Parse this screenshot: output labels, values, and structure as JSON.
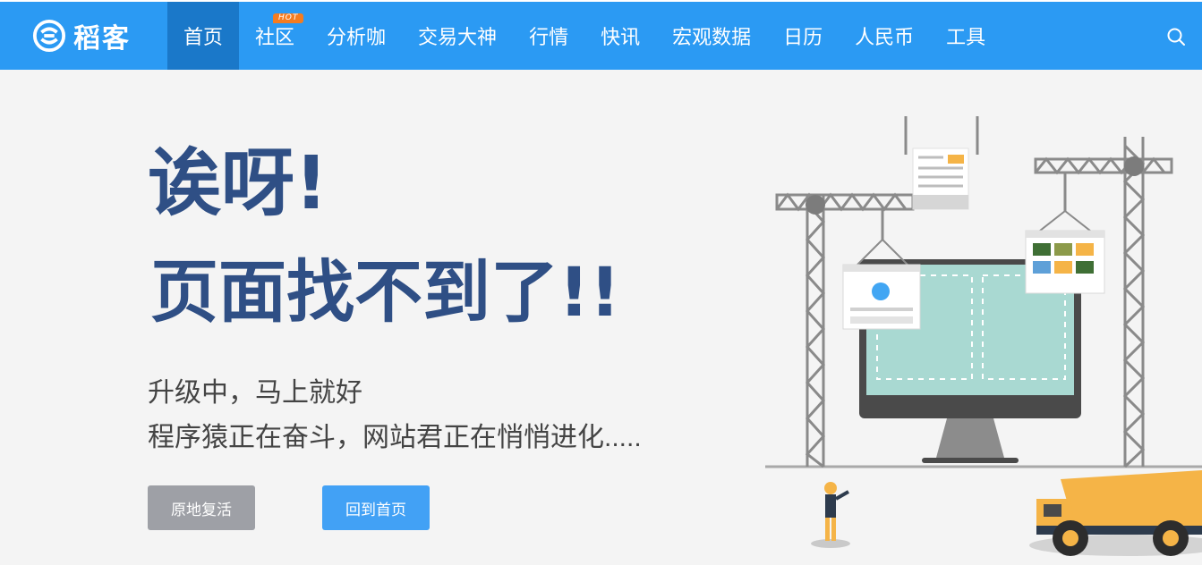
{
  "header": {
    "logo_text": "稻客",
    "nav": [
      {
        "label": "首页",
        "active": true
      },
      {
        "label": "社区",
        "badge": "HOT"
      },
      {
        "label": "分析咖"
      },
      {
        "label": "交易大神"
      },
      {
        "label": "行情"
      },
      {
        "label": "快讯"
      },
      {
        "label": "宏观数据"
      },
      {
        "label": "日历"
      },
      {
        "label": "人民币"
      },
      {
        "label": "工具"
      }
    ],
    "search_icon": "search-icon",
    "bg_color": "#2b9af3",
    "active_color": "#1a78c9"
  },
  "main": {
    "headline1": "诶呀!",
    "headline2": "页面找不到了!!",
    "subtitle1": "升级中，马上就好",
    "subtitle2": "程序猿正在奋斗，网站君正在悄悄进化.....",
    "btn_revive": "原地复活",
    "btn_home": "回到首页",
    "headline_color": "#2f4f85"
  }
}
